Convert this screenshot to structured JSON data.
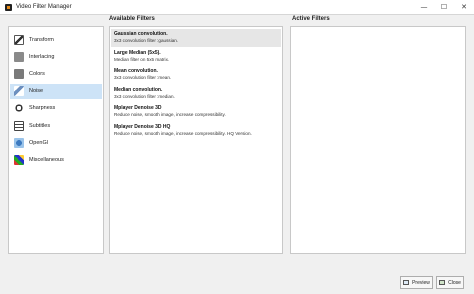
{
  "window": {
    "title": "Video Filter Manager",
    "minimize_glyph": "—",
    "maximize_glyph": "☐",
    "close_glyph": "✕"
  },
  "headers": {
    "available": "Available Filters",
    "active": "Active Filters"
  },
  "categories": [
    {
      "label": "Transform",
      "icon": "transform-icon",
      "selected": false
    },
    {
      "label": "Interlacing",
      "icon": "interlacing-icon",
      "selected": false
    },
    {
      "label": "Colors",
      "icon": "colors-icon",
      "selected": false
    },
    {
      "label": "Noise",
      "icon": "noise-icon",
      "selected": true
    },
    {
      "label": "Sharpness",
      "icon": "sharpness-icon",
      "selected": false
    },
    {
      "label": "Subtitles",
      "icon": "subtitles-icon",
      "selected": false
    },
    {
      "label": "OpenGl",
      "icon": "opengl-icon",
      "selected": false
    },
    {
      "label": "Miscellaneous",
      "icon": "miscellaneous-icon",
      "selected": false
    }
  ],
  "filters": [
    {
      "name": "Gaussian convolution.",
      "desc": "3x3 convolution filter :gaussian.",
      "selected": true
    },
    {
      "name": "Large Median (5x5).",
      "desc": "Median filter on 5x5 matrix.",
      "selected": false
    },
    {
      "name": "Mean convolution.",
      "desc": "3x3 convolution filter :mean.",
      "selected": false
    },
    {
      "name": "Median convolution.",
      "desc": "3x3 convolution filter :median.",
      "selected": false
    },
    {
      "name": "Mplayer Denoise 3D",
      "desc": "Reduce noise, smooth image, increase compressibility.",
      "selected": false
    },
    {
      "name": "Mplayer Denoise 3D HQ",
      "desc": "Reduce noise, smooth image, increase compressibility. HQ Version.",
      "selected": false
    }
  ],
  "buttons": {
    "preview": "Preview",
    "close": "Close"
  },
  "colors": {
    "selection": "#cde3f7",
    "accent_orange": "#e58a1a"
  }
}
